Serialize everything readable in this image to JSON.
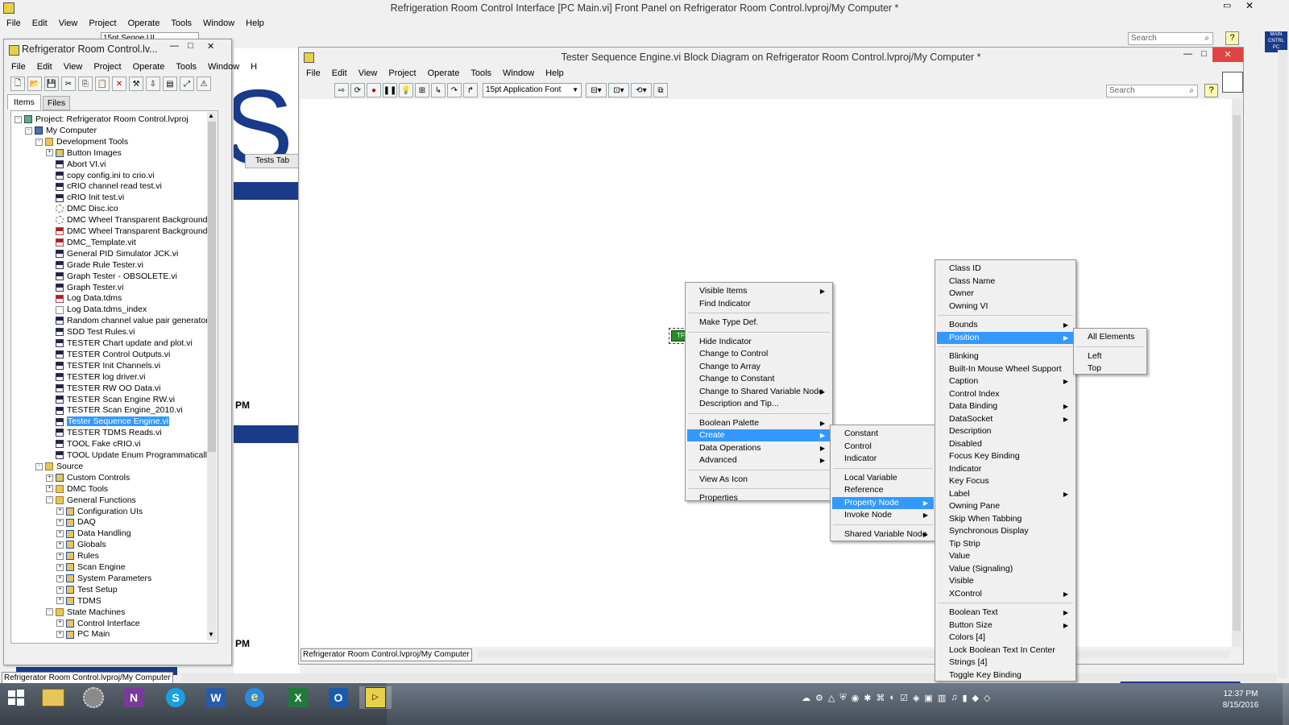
{
  "main_window": {
    "title": "Refrigeration Room Control Interface [PC Main.vi] Front Panel on Refrigerator Room Control.lvproj/My Computer *",
    "menu": [
      "File",
      "Edit",
      "View",
      "Project",
      "Operate",
      "Tools",
      "Window",
      "Help"
    ],
    "font_select": "15pt Segoe UI",
    "search_placeholder": "Search",
    "help": "?",
    "vi_icon": "MAIN CNTRL PC"
  },
  "front_panel": {
    "big_letter": "S",
    "tab_label": "Tests Tab",
    "pm_label_1": "PM",
    "pm_label_2": "PM"
  },
  "project_window": {
    "title": "Refrigerator Room Control.lv...",
    "menu": [
      "File",
      "Edit",
      "View",
      "Project",
      "Operate",
      "Tools",
      "Window",
      "H"
    ],
    "tabs": [
      "Items",
      "Files"
    ],
    "status_path": "Refrigerator Room Control.lvproj/My Computer",
    "tree": [
      {
        "label": "Project: Refrigerator Room Control.lvproj",
        "level": 0,
        "icon": "proj",
        "exp": "-"
      },
      {
        "label": "My Computer",
        "level": 1,
        "icon": "pc",
        "exp": "-"
      },
      {
        "label": "Development Tools",
        "level": 2,
        "icon": "folder",
        "exp": "-"
      },
      {
        "label": "Button Images",
        "level": 3,
        "icon": "lib",
        "exp": "+"
      },
      {
        "label": "Abort VI.vi",
        "level": 3,
        "icon": "vi"
      },
      {
        "label": "copy config.ini to crio.vi",
        "level": 3,
        "icon": "vi"
      },
      {
        "label": "cRIO channel read test.vi",
        "level": 3,
        "icon": "vi"
      },
      {
        "label": "cRIO Init test.vi",
        "level": 3,
        "icon": "vi"
      },
      {
        "label": "DMC Disc.ico",
        "level": 3,
        "icon": "disc"
      },
      {
        "label": "DMC Wheel Transparent Background.i",
        "level": 3,
        "icon": "disc"
      },
      {
        "label": "DMC Wheel Transparent Background.p",
        "level": 3,
        "icon": "vit"
      },
      {
        "label": "DMC_Template.vit",
        "level": 3,
        "icon": "vit"
      },
      {
        "label": "General PID Simulator JCK.vi",
        "level": 3,
        "icon": "vi"
      },
      {
        "label": "Grade Rule Tester.vi",
        "level": 3,
        "icon": "vi"
      },
      {
        "label": "Graph Tester - OBSOLETE.vi",
        "level": 3,
        "icon": "vi"
      },
      {
        "label": "Graph Tester.vi",
        "level": 3,
        "icon": "vi"
      },
      {
        "label": "Log Data.tdms",
        "level": 3,
        "icon": "vit"
      },
      {
        "label": "Log Data.tdms_index",
        "level": 3,
        "icon": "file"
      },
      {
        "label": "Random channel value pair generator.",
        "level": 3,
        "icon": "vi"
      },
      {
        "label": "SDD Test Rules.vi",
        "level": 3,
        "icon": "vi"
      },
      {
        "label": "TESTER Chart update and plot.vi",
        "level": 3,
        "icon": "vi"
      },
      {
        "label": "TESTER Control Outputs.vi",
        "level": 3,
        "icon": "vi"
      },
      {
        "label": "TESTER Init Channels.vi",
        "level": 3,
        "icon": "vi"
      },
      {
        "label": "TESTER log driver.vi",
        "level": 3,
        "icon": "vi"
      },
      {
        "label": "TESTER RW OO Data.vi",
        "level": 3,
        "icon": "vi"
      },
      {
        "label": "TESTER Scan Engine RW.vi",
        "level": 3,
        "icon": "vi"
      },
      {
        "label": "TESTER Scan Engine_2010.vi",
        "level": 3,
        "icon": "vi"
      },
      {
        "label": "Tester Sequence Engine.vi",
        "level": 3,
        "icon": "vi",
        "selected": true
      },
      {
        "label": "TESTER TDMS Reads.vi",
        "level": 3,
        "icon": "vi"
      },
      {
        "label": "TOOL Fake cRIO.vi",
        "level": 3,
        "icon": "vi"
      },
      {
        "label": "TOOL Update Enum Programmatically",
        "level": 3,
        "icon": "vi"
      },
      {
        "label": "Source",
        "level": 2,
        "icon": "folder",
        "exp": "-"
      },
      {
        "label": "Custom Controls",
        "level": 3,
        "icon": "lib",
        "exp": "+"
      },
      {
        "label": "DMC Tools",
        "level": 3,
        "icon": "folder",
        "exp": "+"
      },
      {
        "label": "General Functions",
        "level": 3,
        "icon": "folder",
        "exp": "-"
      },
      {
        "label": "Configuration UIs",
        "level": 4,
        "icon": "lib",
        "exp": "+"
      },
      {
        "label": "DAQ",
        "level": 4,
        "icon": "lib",
        "exp": "+"
      },
      {
        "label": "Data Handling",
        "level": 4,
        "icon": "lib",
        "exp": "+"
      },
      {
        "label": "Globals",
        "level": 4,
        "icon": "lib",
        "exp": "+"
      },
      {
        "label": "Rules",
        "level": 4,
        "icon": "lib",
        "exp": "+"
      },
      {
        "label": "Scan Engine",
        "level": 4,
        "icon": "lib",
        "exp": "+"
      },
      {
        "label": "System Parameters",
        "level": 4,
        "icon": "lib",
        "exp": "+"
      },
      {
        "label": "Test Setup",
        "level": 4,
        "icon": "lib",
        "exp": "+"
      },
      {
        "label": "TDMS",
        "level": 4,
        "icon": "lib",
        "exp": "+"
      },
      {
        "label": "State Machines",
        "level": 3,
        "icon": "folder",
        "exp": "-"
      },
      {
        "label": "Control Interface",
        "level": 4,
        "icon": "lib",
        "exp": "+"
      },
      {
        "label": "PC Main",
        "level": 4,
        "icon": "lib",
        "exp": "+"
      }
    ]
  },
  "block_diagram": {
    "title": "Tester Sequence Engine.vi Block Diagram on Refrigerator Room Control.lvproj/My Computer *",
    "menu": [
      "File",
      "Edit",
      "View",
      "Project",
      "Operate",
      "Tools",
      "Window",
      "Help"
    ],
    "font_select": "15pt Application Font",
    "search_placeholder": "Search",
    "status_path": "Refrigerator Room Control.lvproj/My Computer",
    "node_label": "TF"
  },
  "menu1": [
    {
      "label": "Visible Items",
      "sub": true
    },
    {
      "label": "Find Indicator"
    },
    {
      "sep": true
    },
    {
      "label": "Make Type Def."
    },
    {
      "sep": true
    },
    {
      "label": "Hide Indicator"
    },
    {
      "label": "Change to Control"
    },
    {
      "label": "Change to Array"
    },
    {
      "label": "Change to Constant"
    },
    {
      "label": "Change to Shared Variable Node",
      "sub": true
    },
    {
      "label": "Description and Tip..."
    },
    {
      "sep": true
    },
    {
      "label": "Boolean Palette",
      "sub": true
    },
    {
      "label": "Create",
      "sub": true,
      "hl": true
    },
    {
      "label": "Data Operations",
      "sub": true
    },
    {
      "label": "Advanced",
      "sub": true
    },
    {
      "sep": true
    },
    {
      "label": "View As Icon"
    },
    {
      "sep": true
    },
    {
      "label": "Properties"
    }
  ],
  "menu2": [
    {
      "label": "Constant"
    },
    {
      "label": "Control"
    },
    {
      "label": "Indicator"
    },
    {
      "sep": true
    },
    {
      "label": "Local Variable"
    },
    {
      "label": "Reference"
    },
    {
      "label": "Property Node",
      "sub": true,
      "hl": true
    },
    {
      "label": "Invoke Node",
      "sub": true
    },
    {
      "sep": true
    },
    {
      "label": "Shared Variable Node",
      "sub": true
    }
  ],
  "menu3": [
    {
      "label": "Class ID"
    },
    {
      "label": "Class Name"
    },
    {
      "label": "Owner"
    },
    {
      "label": "Owning VI"
    },
    {
      "sep": true
    },
    {
      "label": "Bounds",
      "sub": true
    },
    {
      "label": "Position",
      "sub": true,
      "hl": true
    },
    {
      "sep": true
    },
    {
      "label": "Blinking"
    },
    {
      "label": "Built-In Mouse Wheel Support"
    },
    {
      "label": "Caption",
      "sub": true
    },
    {
      "label": "Control Index"
    },
    {
      "label": "Data Binding",
      "sub": true
    },
    {
      "label": "DataSocket",
      "sub": true
    },
    {
      "label": "Description"
    },
    {
      "label": "Disabled"
    },
    {
      "label": "Focus Key Binding"
    },
    {
      "label": "Indicator"
    },
    {
      "label": "Key Focus"
    },
    {
      "label": "Label",
      "sub": true
    },
    {
      "label": "Owning Pane"
    },
    {
      "label": "Skip When Tabbing"
    },
    {
      "label": "Synchronous Display"
    },
    {
      "label": "Tip Strip"
    },
    {
      "label": "Value"
    },
    {
      "label": "Value (Signaling)"
    },
    {
      "label": "Visible"
    },
    {
      "label": "XControl",
      "sub": true
    },
    {
      "sep": true
    },
    {
      "label": "Boolean Text",
      "sub": true
    },
    {
      "label": "Button Size",
      "sub": true
    },
    {
      "label": "Colors [4]"
    },
    {
      "label": "Lock Boolean Text In Center"
    },
    {
      "label": "Strings [4]"
    },
    {
      "label": "Toggle Key Binding"
    }
  ],
  "menu4": [
    {
      "label": "All Elements"
    },
    {
      "sep": true
    },
    {
      "label": "Left"
    },
    {
      "label": "Top"
    }
  ],
  "taskbar": {
    "time": "12:37 PM",
    "date": "8/15/2016",
    "apps": [
      "windows-start-icon",
      "file-explorer-icon",
      "app-icon",
      "onenote-icon",
      "skype-icon",
      "word-icon",
      "internet-explorer-icon",
      "excel-icon",
      "outlook-icon",
      "labview-icon"
    ]
  },
  "colors": {
    "selection": "#3399ff",
    "menu_bg": "#f0f0f0",
    "navy": "#1a3a8a"
  }
}
